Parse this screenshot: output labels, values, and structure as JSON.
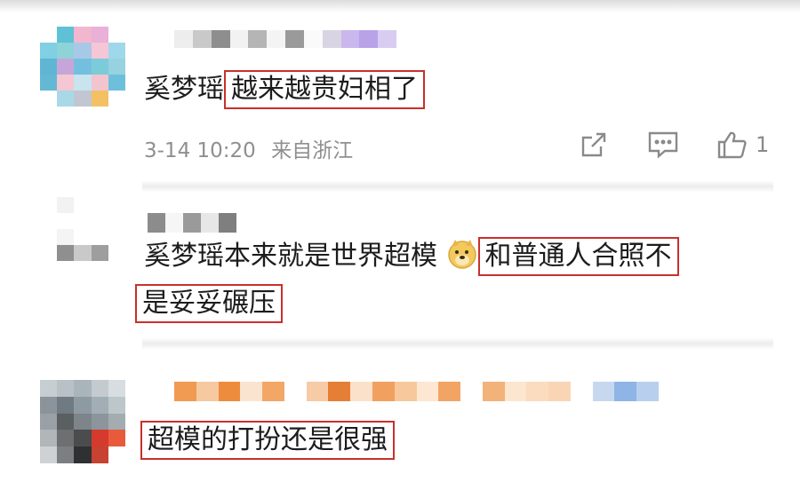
{
  "colors": {
    "highlight_border": "#c9302c",
    "meta_text": "#8f8f8f",
    "body_text": "#1c1c1c"
  },
  "comments": [
    {
      "prefix": "奚梦瑶",
      "highlight": "越来越贵妇相了",
      "time": "3-14 10:20",
      "source": "来自浙江",
      "actions": {
        "share_icon": "share-icon",
        "comment_icon": "comment-icon",
        "like_icon": "thumbs-up-icon",
        "like_count": "1"
      }
    },
    {
      "prefix": "奚梦瑶本来就是世界超模",
      "emoji": "doge-emoji",
      "highlight_line1": "和普通人合照不",
      "highlight_line2": "是妥妥碾压"
    },
    {
      "highlight": "超模的打扮还是很强"
    }
  ]
}
